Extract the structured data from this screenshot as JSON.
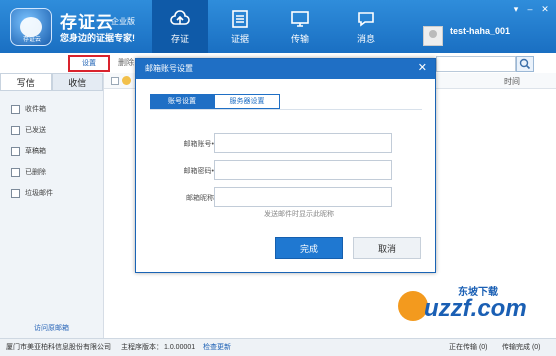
{
  "header": {
    "logo_sub": "存证云",
    "brand": "存证云",
    "edition": "企业版",
    "slogan": "您身边的证据专家!",
    "nav": [
      {
        "label": "存证",
        "icon": "cloud-upload-icon"
      },
      {
        "label": "证据",
        "icon": "list-icon"
      },
      {
        "label": "传输",
        "icon": "monitor-icon"
      },
      {
        "label": "消息",
        "icon": "chat-icon"
      }
    ],
    "username": "test-haha_001"
  },
  "toolbar": {
    "settings_label": "设置",
    "delete_label": "删除"
  },
  "sidebar": {
    "tabs": [
      "写信",
      "收信"
    ],
    "folders": [
      {
        "label": "收件箱",
        "icon": "inbox-icon"
      },
      {
        "label": "已发送",
        "icon": "sent-icon"
      },
      {
        "label": "草稿箱",
        "icon": "draft-icon"
      },
      {
        "label": "已删除",
        "icon": "deleted-icon"
      },
      {
        "label": "垃圾邮件",
        "icon": "trash-icon"
      }
    ],
    "visit_mail": "访问原邮箱"
  },
  "list": {
    "time_header": "时间"
  },
  "dialog": {
    "title": "邮箱账号设置",
    "tabs": [
      "账号设置",
      "服务器设置"
    ],
    "fields": [
      {
        "label": "邮箱账号•",
        "value": ""
      },
      {
        "label": "邮箱密码•",
        "value": ""
      },
      {
        "label": "邮箱昵称",
        "value": ""
      }
    ],
    "hint": "发送邮件时显示此昵称",
    "ok_label": "完成",
    "cancel_label": "取消"
  },
  "status": {
    "company": "厦门市美亚柏科信息股份有限公司",
    "version_label": "主程序版本：",
    "version": "1.0.00001",
    "update": "检查更新",
    "transfer_status": "正在传输 (0)",
    "done_status": "传输完成 (0)"
  },
  "watermark": {
    "site": "uzzf.com",
    "tagline": "东坡下载"
  },
  "colors": {
    "header_blue": "#1f6fc5",
    "highlight_red": "#d9232d"
  }
}
